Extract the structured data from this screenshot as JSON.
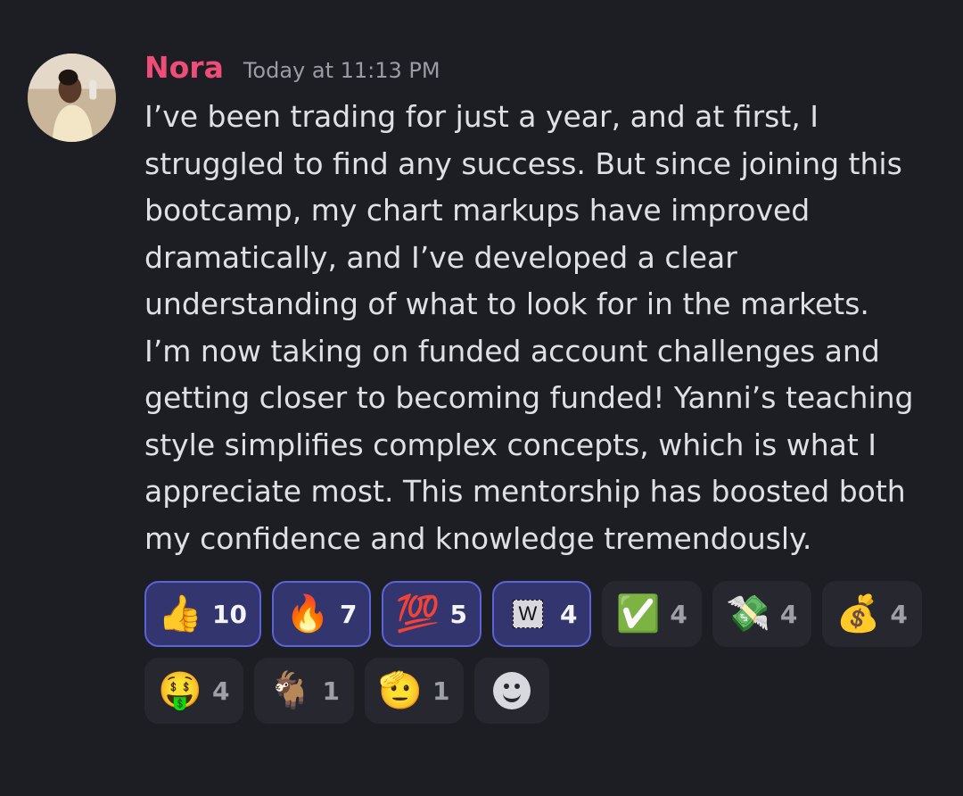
{
  "message": {
    "author": "Nora",
    "timestamp": "Today at 11:13 PM",
    "lines": [
      "I’ve been trading for just a year, and at first, I",
      "struggled to find any success. But since joining this",
      "bootcamp, my chart markups have improved",
      "dramatically, and I’ve developed a clear",
      "understanding of what to look for in the markets.",
      "I’m now taking on funded account challenges and",
      "getting closer to becoming funded! Yanni’s teaching",
      "style simplifies complex concepts, which is what I",
      "appreciate most. This mentorship has boosted both",
      "my confidence and knowledge tremendously."
    ]
  },
  "reactions": [
    {
      "icon": "thumbs-up-icon",
      "emoji": "👍",
      "count": "10",
      "active": true
    },
    {
      "icon": "fire-icon",
      "emoji": "🔥",
      "count": "7",
      "active": true
    },
    {
      "icon": "hundred-points-icon",
      "emoji": "💯",
      "count": "5",
      "active": true
    },
    {
      "icon": "w-emoji-icon",
      "emoji": "W",
      "count": "4",
      "active": true
    },
    {
      "icon": "check-mark-icon",
      "emoji": "✅",
      "count": "4",
      "active": false
    },
    {
      "icon": "money-with-wings-icon",
      "emoji": "💸",
      "count": "4",
      "active": false
    },
    {
      "icon": "money-bag-icon",
      "emoji": "💰",
      "count": "4",
      "active": false
    },
    {
      "icon": "money-mouth-face-icon",
      "emoji": "🤑",
      "count": "4",
      "active": false
    },
    {
      "icon": "goat-icon",
      "emoji": "🐐",
      "count": "1",
      "active": false
    },
    {
      "icon": "saluting-face-icon",
      "emoji": "🫡",
      "count": "1",
      "active": false
    }
  ],
  "colors": {
    "background": "#1d1d24",
    "username": "#ee4d78",
    "active_reaction_bg": "#32356e",
    "active_reaction_border": "#5a63d8"
  }
}
